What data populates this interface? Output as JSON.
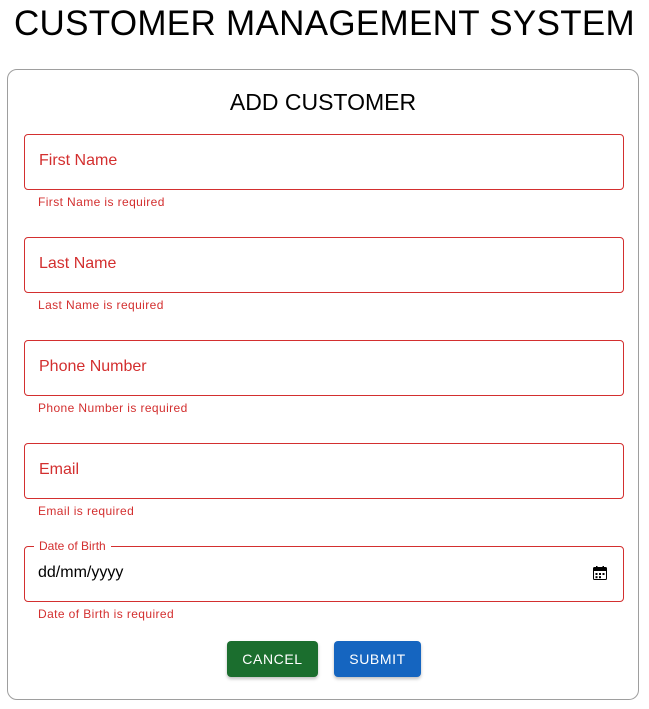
{
  "app": {
    "title": "CUSTOMER MANAGEMENT SYSTEM"
  },
  "form": {
    "title": "ADD CUSTOMER",
    "fields": [
      {
        "label": "First Name",
        "error": "First Name is required"
      },
      {
        "label": "Last Name",
        "error": "Last Name is required"
      },
      {
        "label": "Phone Number",
        "error": "Phone Number is required"
      },
      {
        "label": "Email",
        "error": "Email is required"
      },
      {
        "label": "Date of Birth",
        "value": "dd/mm/yyyy",
        "error": "Date of Birth is required"
      }
    ],
    "buttons": {
      "cancel": "CANCEL",
      "submit": "SUBMIT"
    }
  },
  "colors": {
    "error": "#d32f2f",
    "cancel": "#1b6e2e",
    "submit": "#1565c0"
  },
  "icons": {
    "date_picker": "calendar-icon"
  }
}
